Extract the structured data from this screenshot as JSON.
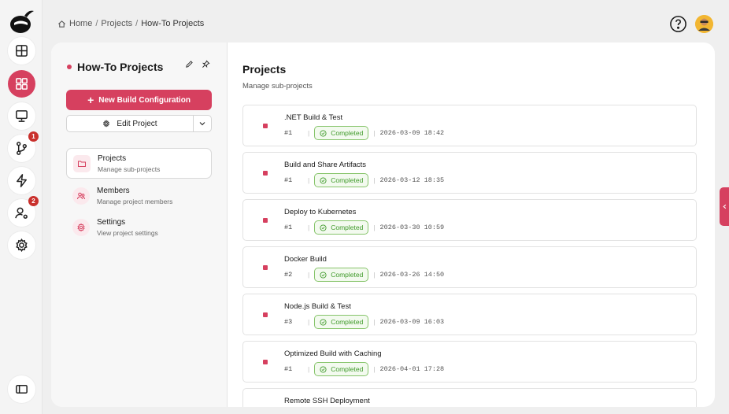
{
  "breadcrumb": {
    "home": "Home",
    "projects": "Projects",
    "current": "How-To Projects"
  },
  "rail": {
    "items": [
      {
        "icon": "dashboard-icon"
      },
      {
        "icon": "projects-grid-icon",
        "active": true
      },
      {
        "icon": "monitor-icon"
      },
      {
        "icon": "git-branch-icon",
        "badge": "1"
      },
      {
        "icon": "lightning-icon"
      },
      {
        "icon": "user-settings-icon",
        "badge": "2"
      },
      {
        "icon": "gear-icon"
      }
    ]
  },
  "panel": {
    "title": "How-To Projects",
    "new_build_label": "New Build Configuration",
    "edit_label": "Edit Project",
    "nav": [
      {
        "label": "Projects",
        "sub": "Manage sub-projects",
        "icon": "folder-icon",
        "active": true
      },
      {
        "label": "Members",
        "sub": "Manage project members",
        "icon": "members-icon"
      },
      {
        "label": "Settings",
        "sub": "View project settings",
        "icon": "gear-icon"
      }
    ]
  },
  "content": {
    "title": "Projects",
    "subtitle": "Manage sub-projects",
    "items": [
      {
        "name": ".NET Build & Test",
        "run": "#1",
        "status": "Completed",
        "time": "2026-03-09 18:42"
      },
      {
        "name": "Build and Share Artifacts",
        "run": "#1",
        "status": "Completed",
        "time": "2026-03-12 18:35"
      },
      {
        "name": "Deploy to Kubernetes",
        "run": "#1",
        "status": "Completed",
        "time": "2026-03-30 10:59"
      },
      {
        "name": "Docker Build",
        "run": "#2",
        "status": "Completed",
        "time": "2026-03-26 14:50"
      },
      {
        "name": "Node.js Build & Test",
        "run": "#3",
        "status": "Completed",
        "time": "2026-03-09 16:03"
      },
      {
        "name": "Optimized Build with Caching",
        "run": "#1",
        "status": "Completed",
        "time": "2026-04-01 17:28"
      },
      {
        "name": "Remote SSH Deployment",
        "run": "",
        "status": "",
        "time": ""
      }
    ]
  },
  "colors": {
    "accent": "#d6405f",
    "success": "#3f9a2a",
    "success_border": "#86c46a"
  }
}
